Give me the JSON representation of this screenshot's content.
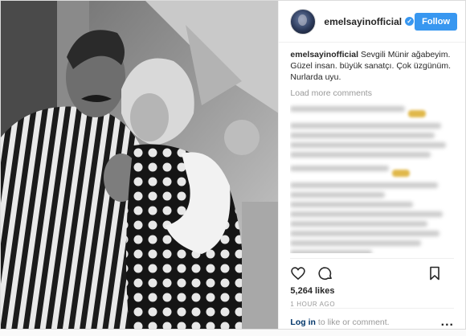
{
  "post": {
    "username": "emelsayinofficial",
    "follow_label": "Follow",
    "caption_user": "emelsayinofficial",
    "caption_text": " Sevgili Münir ağabeyim. Güzel insan. büyük sanatçı. Çok üzgünüm. Nurlarda uyu.",
    "load_more": "Load more comments",
    "likes": "5,264 likes",
    "time": "1 HOUR AGO",
    "login_link": "Log in",
    "login_rest": "to like or comment.",
    "more": "..."
  },
  "colors": {
    "accent": "#3897f0",
    "link": "#003569",
    "muted": "#999999"
  },
  "icons": [
    "heart-icon",
    "comment-icon",
    "verified-icon",
    "bookmark-icon",
    "more-options-icon"
  ]
}
